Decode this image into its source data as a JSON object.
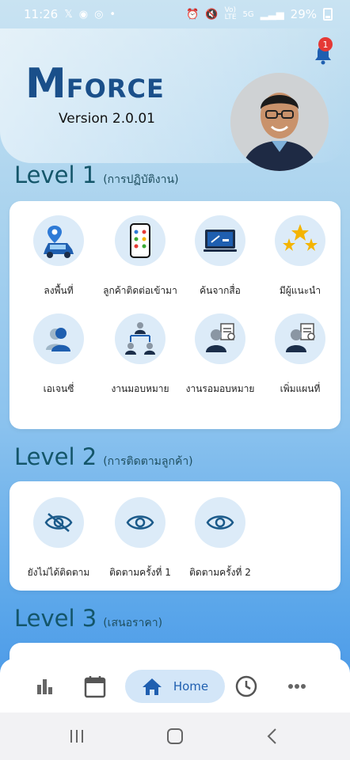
{
  "status_bar": {
    "time": "11:26",
    "battery": "29%",
    "network": "5G",
    "icons": [
      "x-icon",
      "line-icon",
      "instagram-icon",
      "alarm-icon",
      "mute-icon",
      "volte-icon",
      "signal-icon",
      "battery-icon"
    ]
  },
  "header": {
    "logo_m": "M",
    "logo_force": "FORCE",
    "version": "Version 2.0.01",
    "notification_count": "1"
  },
  "level1": {
    "title": "Level 1",
    "subtitle": "(การปฏิบัติงาน)",
    "items": [
      {
        "label": "ลงพื้นที่",
        "icon": "car-location-icon"
      },
      {
        "label": "ลูกค้าติดต่อเข้ามา",
        "icon": "phone-apps-icon"
      },
      {
        "label": "ค้นจากสื่อ",
        "icon": "media-screen-icon"
      },
      {
        "label": "มีผู้แนะนำ",
        "icon": "stars-icon"
      },
      {
        "label": "เอเจนซี่",
        "icon": "agent-icon"
      },
      {
        "label": "งานมอบหมาย",
        "icon": "assignment-hierarchy-icon"
      },
      {
        "label": "งานรอมอบหมาย",
        "icon": "pending-assignment-icon"
      },
      {
        "label": "เพิ่มแผนที่",
        "icon": "add-plan-icon"
      }
    ]
  },
  "level2": {
    "title": "Level 2",
    "subtitle": "(การติดตามลูกค้า)",
    "items": [
      {
        "label": "ยังไม่ได้ติดตาม",
        "icon": "eye-off-icon"
      },
      {
        "label": "ติดตามครั้งที่ 1",
        "icon": "eye-icon"
      },
      {
        "label": "ติดตามครั้งที่ 2",
        "icon": "eye-icon"
      }
    ]
  },
  "level3": {
    "title": "Level 3",
    "subtitle": "(เสนอราคา)"
  },
  "bottom_nav": {
    "items": [
      {
        "icon": "bar-chart-icon"
      },
      {
        "icon": "calendar-icon"
      },
      {
        "icon": "home-icon",
        "label": "Home",
        "active": true
      },
      {
        "icon": "clock-icon"
      },
      {
        "icon": "more-icon"
      }
    ]
  },
  "colors": {
    "accent": "#1f5fb0",
    "heading": "#14566a",
    "tile_bg": "#dcebf8",
    "badge": "#e53935"
  }
}
